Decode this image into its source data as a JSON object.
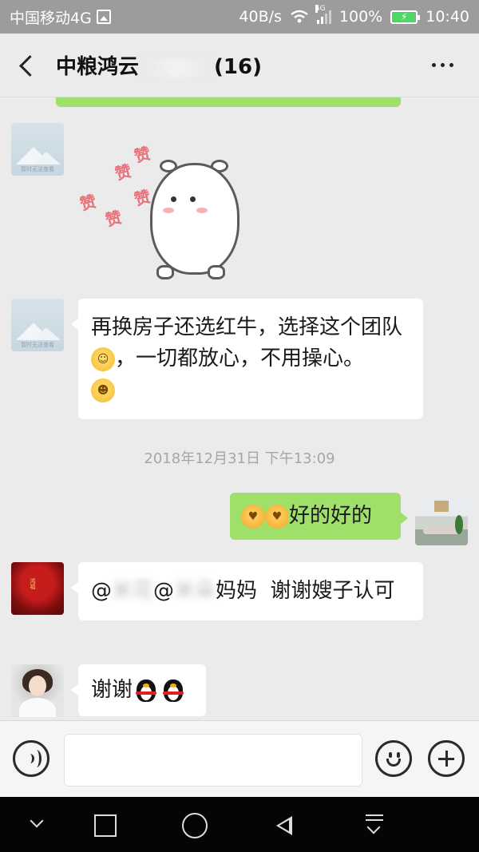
{
  "status_bar": {
    "carrier": "中国移动4G",
    "speed": "40B/s",
    "network": "4G",
    "battery": "100%",
    "time": "10:40"
  },
  "header": {
    "title_prefix": "中粮鸿云",
    "title_suffix": "(16)"
  },
  "messages": {
    "msg1_text": "再换房子还选红牛，选择这个团队",
    "msg1_text_b": "，一切都放心，不用操心。",
    "timestamp": "2018年12月31日 下午13:09",
    "msg2_text": "好的好的",
    "msg3_text_a": "@",
    "msg3_text_b": "@",
    "msg3_text_c": "妈妈  谢谢嫂子认可",
    "msg4_text": "谢谢",
    "placeholder_caption": "暂时无法查看"
  },
  "sticker": {
    "zan": "赞"
  },
  "icons": {
    "back": "back-arrow-icon",
    "more": "more-dots-icon",
    "voice": "voice-icon",
    "emoji": "smile-icon",
    "plus": "plus-icon"
  },
  "colors": {
    "my_bubble": "#9ee069",
    "other_bubble": "#ffffff",
    "background": "#ebebeb",
    "status_bar": "#9c9c9c"
  }
}
